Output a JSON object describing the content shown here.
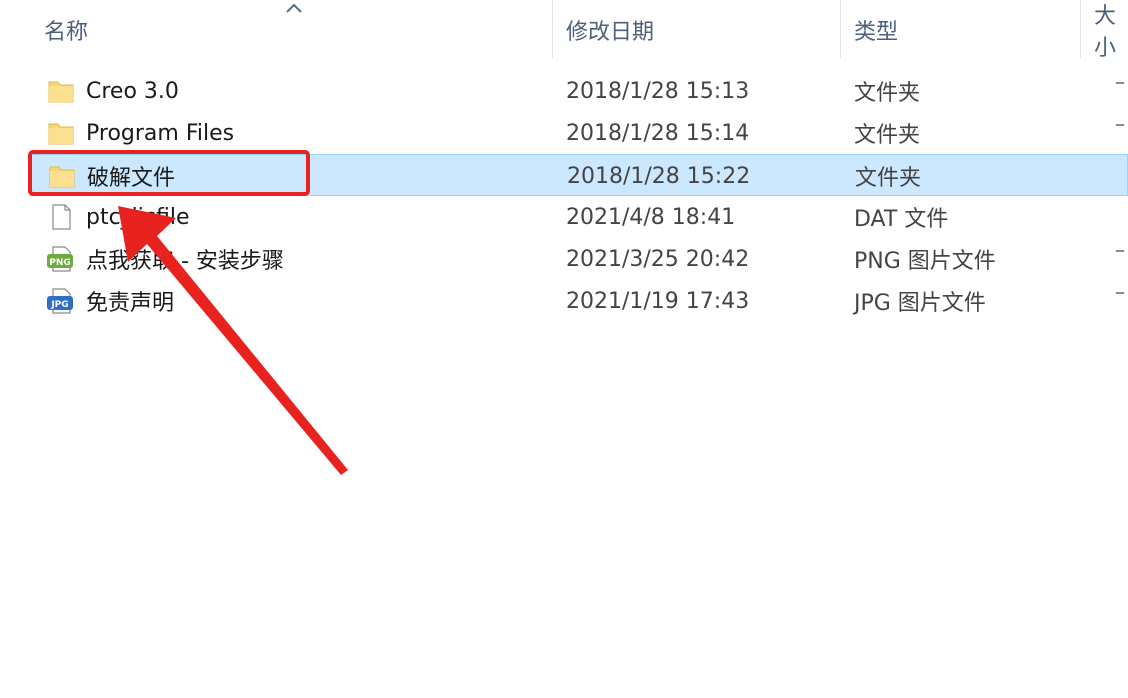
{
  "columns": {
    "name": "名称",
    "modified": "修改日期",
    "type": "类型",
    "size": "大小"
  },
  "files": [
    {
      "name": "Creo 3.0",
      "modified": "2018/1/28 15:13",
      "type": "文件夹",
      "icon": "folder-icon",
      "selected": false
    },
    {
      "name": "Program Files",
      "modified": "2018/1/28 15:14",
      "type": "文件夹",
      "icon": "folder-icon",
      "selected": false
    },
    {
      "name": "破解文件",
      "modified": "2018/1/28 15:22",
      "type": "文件夹",
      "icon": "folder-icon",
      "selected": true
    },
    {
      "name": "ptc_licfile",
      "modified": "2021/4/8 18:41",
      "type": "DAT 文件",
      "icon": "document-icon",
      "selected": false
    },
    {
      "name": "点我获取 - 安装步骤",
      "modified": "2021/3/25 20:42",
      "type": "PNG 图片文件",
      "icon": "png-file-icon",
      "selected": false
    },
    {
      "name": "免责声明",
      "modified": "2021/1/19 17:43",
      "type": "JPG 图片文件",
      "icon": "jpg-file-icon",
      "selected": false
    }
  ],
  "annotation": {
    "highlight_color": "#e8231f",
    "target": "破解文件"
  },
  "colors": {
    "header_text": "#4c607a",
    "selection_bg": "#cce8ff",
    "selection_border": "#99d1ff",
    "folder": "#f8d775"
  }
}
